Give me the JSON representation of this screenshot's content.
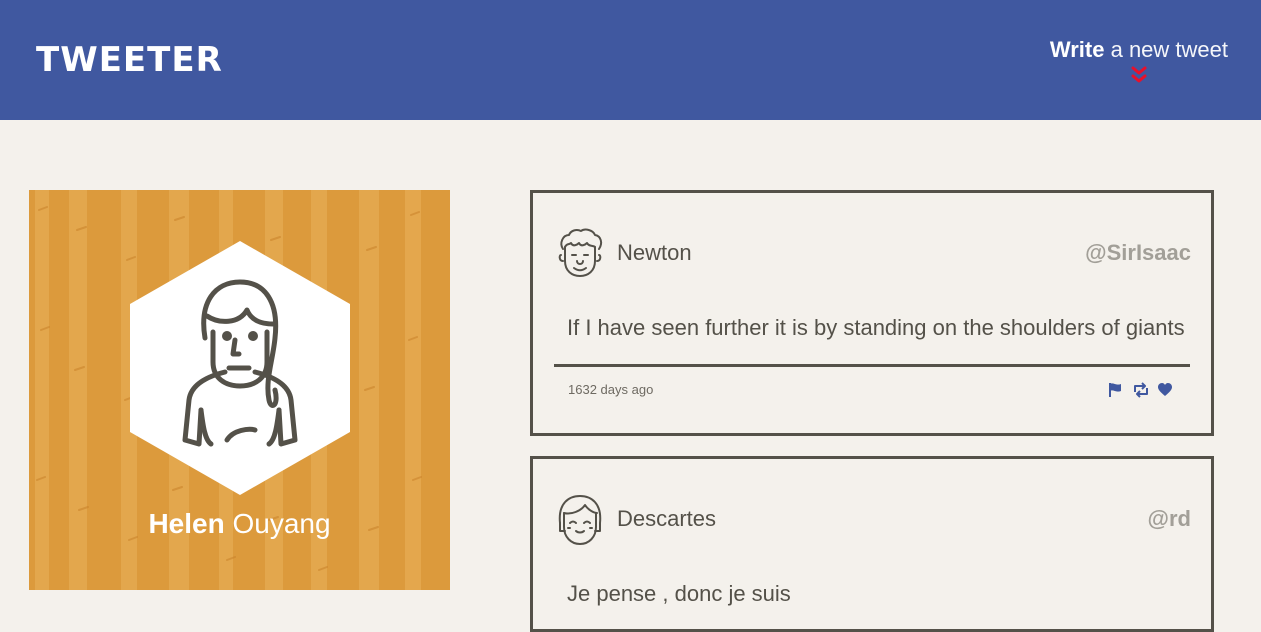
{
  "nav": {
    "logo": "TWEETER",
    "compose_bold": "Write",
    "compose_rest": " a new tweet",
    "compose_icon": "double-chevron-down-icon",
    "compose_icon_color": "#e8102b"
  },
  "profile": {
    "first_name": "Helen",
    "last_name": " Ouyang",
    "avatar_icon": "woman-avatar-icon",
    "background_color": "#dc9a3c"
  },
  "tweets": [
    {
      "name": "Newton",
      "handle": "@SirIsaac",
      "content": "If I have seen further it is by standing on the shoulders of giants",
      "time": "1632 days ago",
      "avatar_icon": "curly-hair-man-avatar-icon",
      "actions": [
        "flag-icon",
        "retweet-icon",
        "heart-icon"
      ]
    },
    {
      "name": "Descartes",
      "handle": "@rd",
      "content": "Je pense , donc je suis",
      "avatar_icon": "bob-hair-avatar-icon"
    }
  ],
  "colors": {
    "nav": "#4058a0",
    "page": "#f4f1ec",
    "text": "#545149",
    "handle": "#a29f98",
    "action_icons": "#4058a0"
  }
}
